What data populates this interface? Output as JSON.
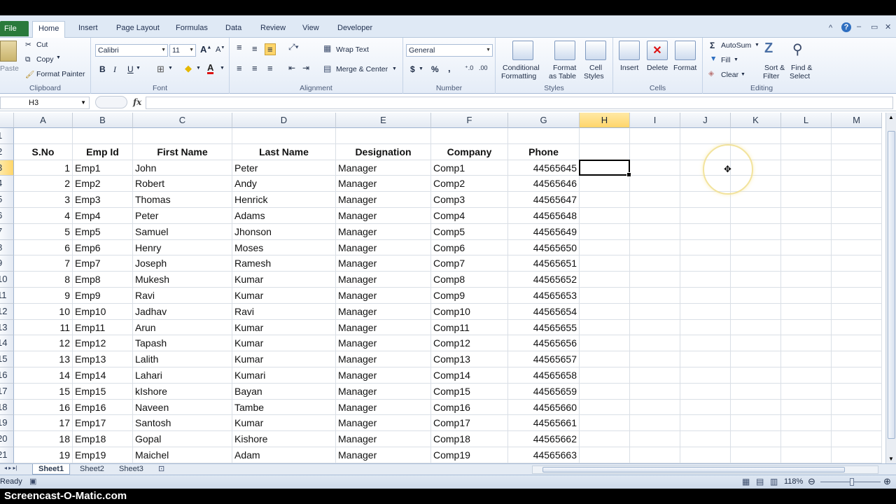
{
  "ribbon_tabs": [
    "File",
    "Home",
    "Insert",
    "Page Layout",
    "Formulas",
    "Data",
    "Review",
    "View",
    "Developer"
  ],
  "clipboard": {
    "paste": "Paste",
    "cut": "Cut",
    "copy": "Copy",
    "format_painter": "Format Painter",
    "label": "Clipboard"
  },
  "font": {
    "name": "Calibri",
    "size": "11",
    "bold": "B",
    "italic": "I",
    "underline": "U",
    "label": "Font"
  },
  "alignment": {
    "wrap_text": "Wrap Text",
    "merge_center": "Merge & Center",
    "label": "Alignment"
  },
  "number": {
    "format": "General",
    "currency": "$",
    "percent": "%",
    "comma": ",",
    "label": "Number"
  },
  "styles": {
    "conditional": "Conditional",
    "conditional2": "Formatting",
    "format_as": "Format",
    "format_as2": "as Table",
    "cell_styles": "Cell",
    "cell_styles2": "Styles",
    "label": "Styles"
  },
  "cells": {
    "insert": "Insert",
    "delete": "Delete",
    "format": "Format",
    "label": "Cells"
  },
  "editing": {
    "autosum": "AutoSum",
    "fill": "Fill",
    "clear": "Clear",
    "sort": "Sort &",
    "sort2": "Filter",
    "find": "Find &",
    "find2": "Select",
    "label": "Editing"
  },
  "formula_bar": {
    "name_box": "H3",
    "fx": "fx",
    "value": ""
  },
  "columns": [
    "A",
    "B",
    "C",
    "D",
    "E",
    "F",
    "G",
    "H",
    "I",
    "J",
    "K",
    "L",
    "M"
  ],
  "selected_column": "H",
  "selected_row": "3",
  "rows": [
    "1",
    "2",
    "3",
    "4",
    "5",
    "6",
    "7",
    "8",
    "9",
    "10",
    "11",
    "12",
    "13",
    "14",
    "15",
    "16",
    "17",
    "18",
    "19",
    "20",
    "21"
  ],
  "table": {
    "headers": [
      "S.No",
      "Emp Id",
      "First Name",
      "Last Name",
      "Designation",
      "Company",
      "Phone"
    ],
    "data": [
      [
        "1",
        "Emp1",
        "John",
        "Peter",
        "Manager",
        "Comp1",
        "44565645"
      ],
      [
        "2",
        "Emp2",
        "Robert",
        "Andy",
        "Manager",
        "Comp2",
        "44565646"
      ],
      [
        "3",
        "Emp3",
        "Thomas",
        "Henrick",
        "Manager",
        "Comp3",
        "44565647"
      ],
      [
        "4",
        "Emp4",
        "Peter",
        "Adams",
        "Manager",
        "Comp4",
        "44565648"
      ],
      [
        "5",
        "Emp5",
        "Samuel",
        "Jhonson",
        "Manager",
        "Comp5",
        "44565649"
      ],
      [
        "6",
        "Emp6",
        "Henry",
        "Moses",
        "Manager",
        "Comp6",
        "44565650"
      ],
      [
        "7",
        "Emp7",
        "Joseph",
        "Ramesh",
        "Manager",
        "Comp7",
        "44565651"
      ],
      [
        "8",
        "Emp8",
        "Mukesh",
        "Kumar",
        "Manager",
        "Comp8",
        "44565652"
      ],
      [
        "9",
        "Emp9",
        "Ravi",
        "Kumar",
        "Manager",
        "Comp9",
        "44565653"
      ],
      [
        "10",
        "Emp10",
        "Jadhav",
        "Ravi",
        "Manager",
        "Comp10",
        "44565654"
      ],
      [
        "11",
        "Emp11",
        "Arun",
        "Kumar",
        "Manager",
        "Comp11",
        "44565655"
      ],
      [
        "12",
        "Emp12",
        "Tapash",
        "Kumar",
        "Manager",
        "Comp12",
        "44565656"
      ],
      [
        "13",
        "Emp13",
        "Lalith",
        "Kumar",
        "Manager",
        "Comp13",
        "44565657"
      ],
      [
        "14",
        "Emp14",
        "Lahari",
        "Kumari",
        "Manager",
        "Comp14",
        "44565658"
      ],
      [
        "15",
        "Emp15",
        "kIshore",
        "Bayan",
        "Manager",
        "Comp15",
        "44565659"
      ],
      [
        "16",
        "Emp16",
        "Naveen",
        "Tambe",
        "Manager",
        "Comp16",
        "44565660"
      ],
      [
        "17",
        "Emp17",
        "Santosh",
        "Kumar",
        "Manager",
        "Comp17",
        "44565661"
      ],
      [
        "18",
        "Emp18",
        "Gopal",
        "Kishore",
        "Manager",
        "Comp18",
        "44565662"
      ],
      [
        "19",
        "Emp19",
        "Maichel",
        "Adam",
        "Manager",
        "Comp19",
        "44565663"
      ]
    ]
  },
  "sheet_tabs": [
    "Sheet1",
    "Sheet2",
    "Sheet3"
  ],
  "active_sheet": "Sheet1",
  "status": {
    "ready": "Ready",
    "zoom": "118%"
  },
  "watermark": "Screencast-O-Matic.com",
  "colors": {
    "accent_file": "#2a7a3b",
    "selection": "#ffd56a",
    "ribbon": "#dfe9f5"
  }
}
